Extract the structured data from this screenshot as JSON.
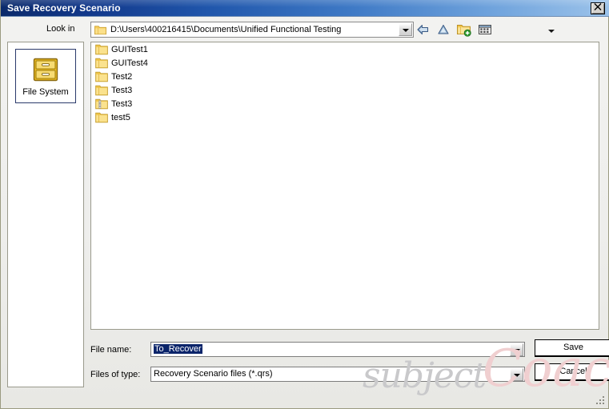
{
  "window": {
    "title": "Save Recovery Scenario",
    "close_label": "×",
    "close_icon": "close-icon",
    "titlebar_gradient_start": "#0b2a6b",
    "titlebar_gradient_end": "#9cc3ea"
  },
  "lookin": {
    "label": "Look in",
    "path": "D:\\Users\\400216415\\Documents\\Unified Functional Testing",
    "folder_icon": "folder-icon",
    "dropdown_icon": "chevron-down-icon"
  },
  "toolbar": {
    "items": [
      {
        "name": "back-icon",
        "tooltip": "Back"
      },
      {
        "name": "up-one-level-icon",
        "tooltip": "Up One Level"
      },
      {
        "name": "new-folder-icon",
        "tooltip": "Create New Folder"
      },
      {
        "name": "view-menu-icon",
        "tooltip": "View Menu"
      }
    ]
  },
  "places": {
    "items": [
      {
        "label": "File System",
        "icon": "file-cabinet-icon",
        "selected": true
      }
    ]
  },
  "filelist": {
    "items": [
      {
        "name": "GUITest1",
        "icon": "folder-icon"
      },
      {
        "name": "GUITest4",
        "icon": "folder-icon"
      },
      {
        "name": "Test2",
        "icon": "folder-icon"
      },
      {
        "name": "Test3",
        "icon": "folder-icon"
      },
      {
        "name": "Test3",
        "icon": "zipped-folder-icon"
      },
      {
        "name": "test5",
        "icon": "folder-icon"
      }
    ]
  },
  "fields": {
    "filename_label": "File name:",
    "filename_value": "To_Recover",
    "filetype_label": "Files of type:",
    "filetype_value": "Recovery Scenario files (*.qrs)"
  },
  "buttons": {
    "save": "Save",
    "cancel": "Cancel"
  },
  "watermark": {
    "word1": "subject",
    "word2": "Coach"
  }
}
